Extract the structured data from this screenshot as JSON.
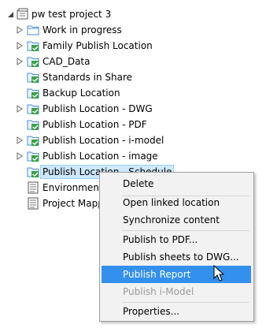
{
  "tree": {
    "root": {
      "label": "pw test project 3",
      "icon": "project-icon"
    },
    "items": [
      {
        "label": "Work in progress",
        "icon": "folder-icon",
        "expandable": true
      },
      {
        "label": "Family Publish Location",
        "icon": "publish-location-icon",
        "expandable": true
      },
      {
        "label": "CAD_Data",
        "icon": "publish-location-icon",
        "expandable": true
      },
      {
        "label": "Standards in Share",
        "icon": "publish-location-icon",
        "expandable": false
      },
      {
        "label": "Backup Location",
        "icon": "publish-location-icon",
        "expandable": false
      },
      {
        "label": "Publish Location - DWG",
        "icon": "publish-location-icon",
        "expandable": true
      },
      {
        "label": "Publish Location - PDF",
        "icon": "publish-location-icon",
        "expandable": false
      },
      {
        "label": "Publish Location - i-model",
        "icon": "publish-location-icon",
        "expandable": true
      },
      {
        "label": "Publish Location - image",
        "icon": "publish-location-icon",
        "expandable": true
      },
      {
        "label": "Publish Location - Schedule",
        "icon": "publish-location-icon",
        "expandable": false,
        "selected": true
      },
      {
        "label": "Environment Mapping",
        "icon": "document-icon",
        "expandable": false
      },
      {
        "label": "Project Mapping",
        "icon": "document-icon",
        "expandable": false
      }
    ]
  },
  "context_menu": {
    "items": [
      {
        "label": "Delete",
        "state": "normal"
      },
      {
        "label": "Open linked location",
        "state": "normal"
      },
      {
        "label": "Synchronize content",
        "state": "normal"
      },
      {
        "label": "Publish to PDF...",
        "state": "normal"
      },
      {
        "label": "Publish sheets to DWG...",
        "state": "normal"
      },
      {
        "label": "Publish Report",
        "state": "highlighted"
      },
      {
        "label": "Publish i-Model",
        "state": "disabled"
      },
      {
        "label": "Properties...",
        "state": "normal"
      }
    ]
  },
  "colors": {
    "highlight": "#3390ee",
    "selection": "#cde8ff",
    "folder_outline": "#4a90d9",
    "publish_green": "#3aa04a"
  }
}
